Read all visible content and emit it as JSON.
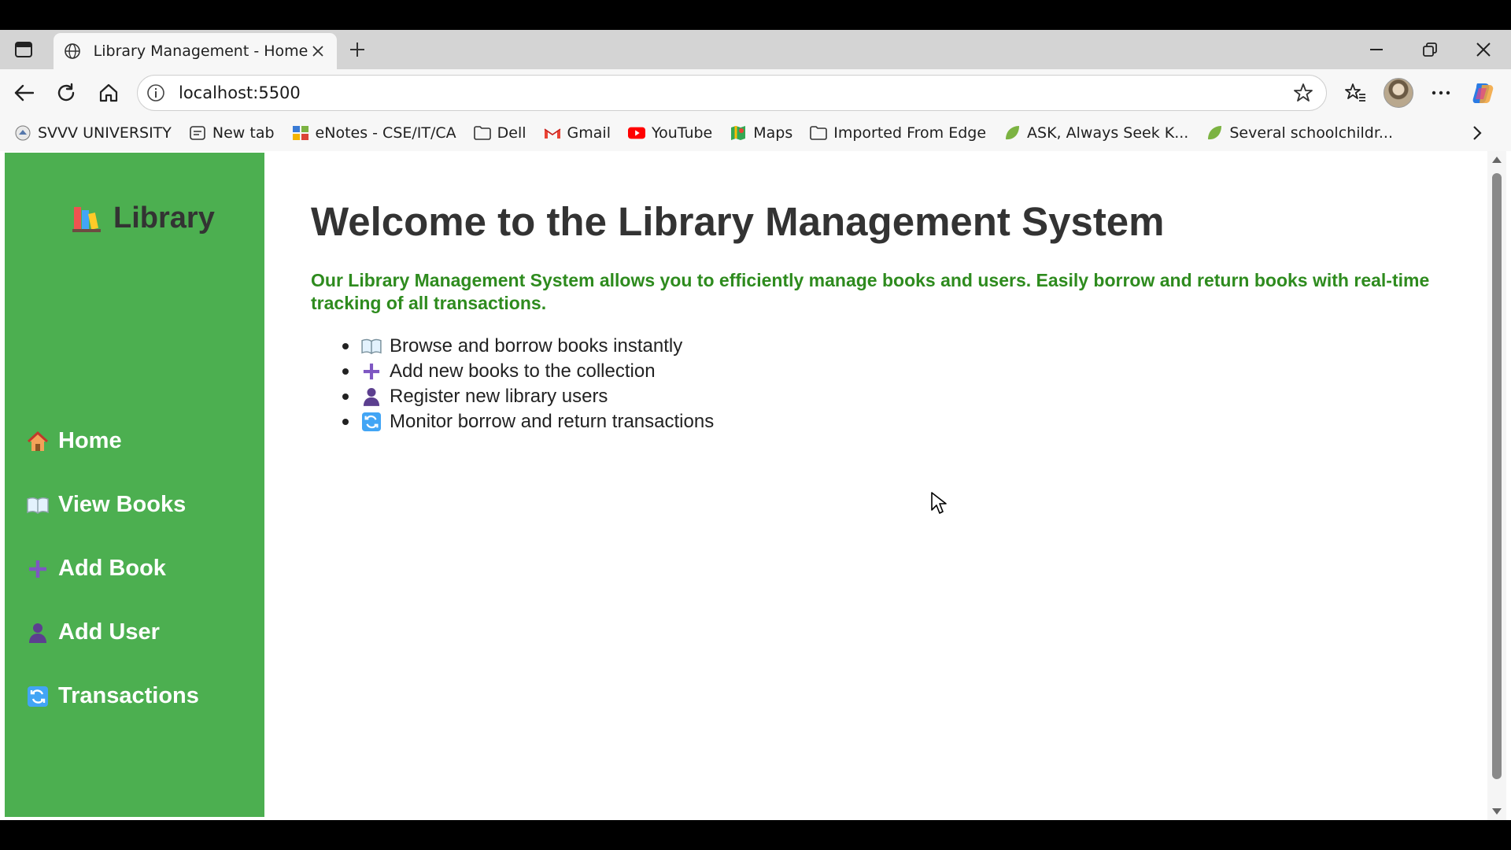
{
  "browser": {
    "tab": {
      "title": "Library Management - Home",
      "favicon": "globe-icon"
    },
    "url": "localhost:5500",
    "bookmarks": [
      {
        "label": "SVVV UNIVERSITY",
        "icon": "university-icon"
      },
      {
        "label": "New tab",
        "icon": "newtab-icon"
      },
      {
        "label": "eNotes - CSE/IT/CA",
        "icon": "enotes-icon"
      },
      {
        "label": "Dell",
        "icon": "folder-icon"
      },
      {
        "label": "Gmail",
        "icon": "gmail-icon"
      },
      {
        "label": "YouTube",
        "icon": "youtube-icon"
      },
      {
        "label": "Maps",
        "icon": "maps-icon"
      },
      {
        "label": "Imported From Edge",
        "icon": "folder-icon"
      },
      {
        "label": "ASK, Always Seek K...",
        "icon": "leaf-icon"
      },
      {
        "label": "Several schoolchildr...",
        "icon": "leaf-icon"
      }
    ]
  },
  "sidebar": {
    "brand": "Library",
    "items": [
      {
        "label": "Home",
        "icon": "house-icon"
      },
      {
        "label": "View Books",
        "icon": "open-book-icon"
      },
      {
        "label": "Add Book",
        "icon": "plus-icon"
      },
      {
        "label": "Add User",
        "icon": "user-icon"
      },
      {
        "label": "Transactions",
        "icon": "refresh-icon"
      }
    ]
  },
  "main": {
    "title": "Welcome to the Library Management System",
    "intro": "Our Library Management System allows you to efficiently manage books and users. Easily borrow and return books with real-time tracking of all transactions.",
    "features": [
      {
        "text": "Browse and borrow books instantly",
        "icon": "open-book-icon"
      },
      {
        "text": "Add new books to the collection",
        "icon": "plus-icon"
      },
      {
        "text": "Register new library users",
        "icon": "user-icon"
      },
      {
        "text": "Monitor borrow and return transactions",
        "icon": "refresh-icon"
      }
    ]
  },
  "colors": {
    "sidebar_bg": "#4caf50",
    "intro_text": "#2e8b1e",
    "heading": "#333333"
  }
}
